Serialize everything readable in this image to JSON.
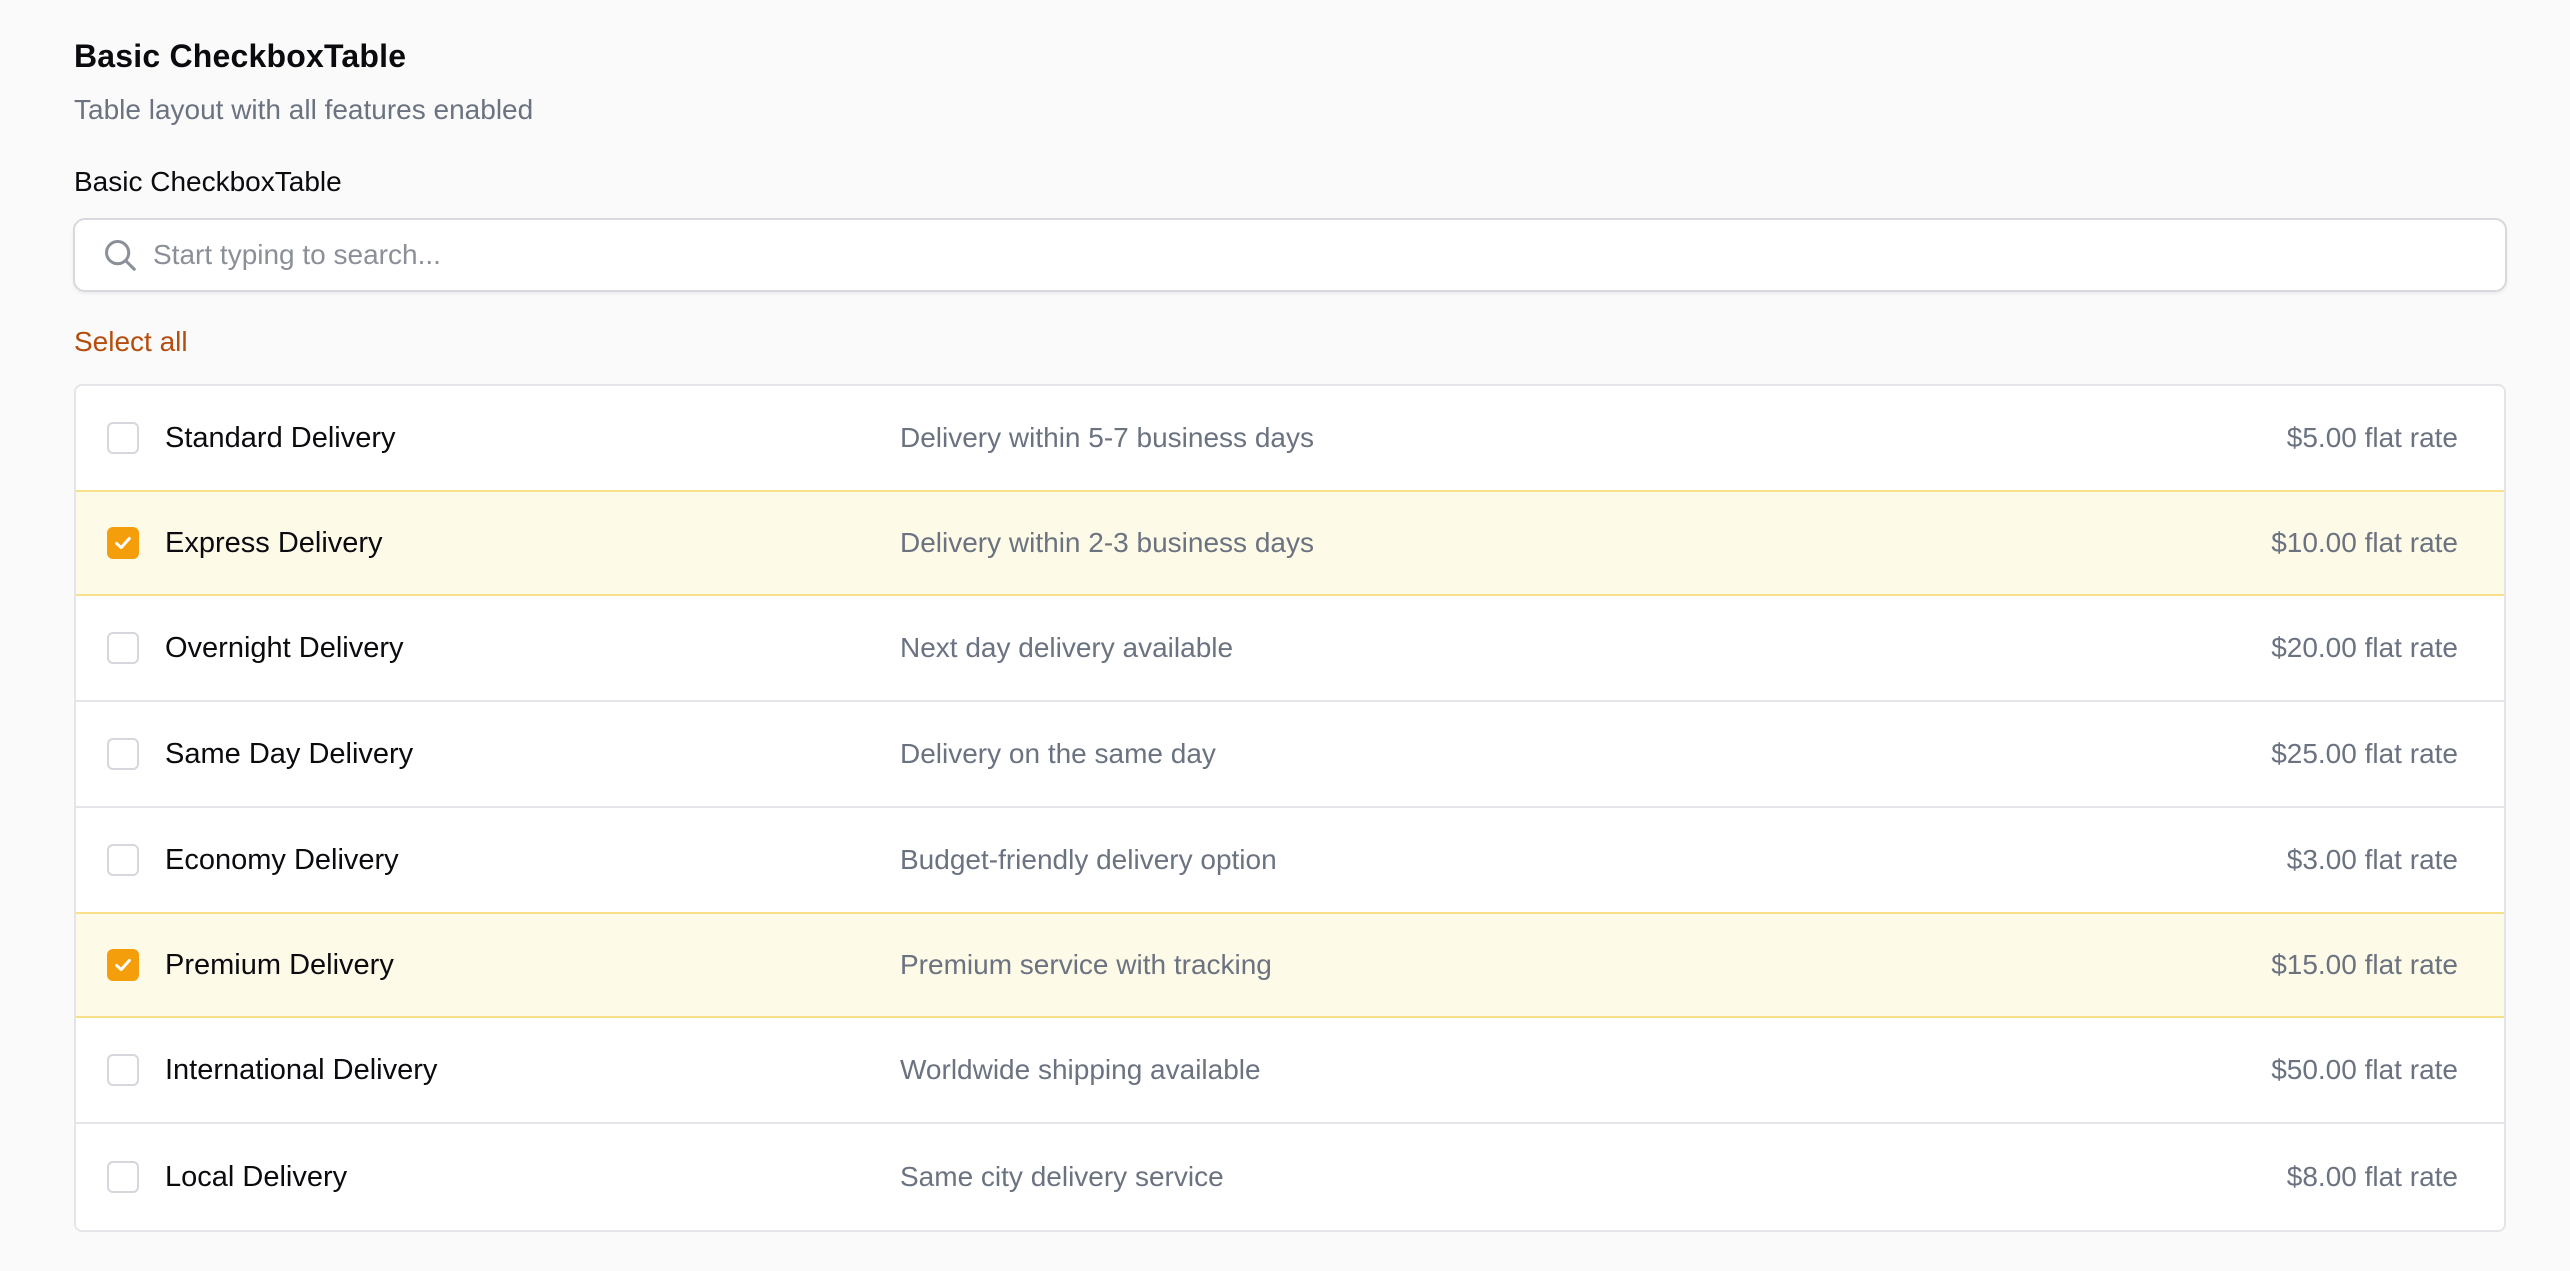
{
  "header": {
    "title": "Basic CheckboxTable",
    "subtitle": "Table layout with all features enabled"
  },
  "field": {
    "label": "Basic CheckboxTable"
  },
  "search": {
    "placeholder": "Start typing to search...",
    "value": "",
    "icon": "search-icon"
  },
  "select_all_label": "Select all",
  "colors": {
    "accent": "#f59e0b",
    "link": "#b44d0d",
    "selected_row_bg": "#fefae8",
    "selected_row_border": "#f7e08a"
  },
  "rows": [
    {
      "name": "Standard Delivery",
      "description": "Delivery within 5-7 business days",
      "price": "$5.00 flat rate",
      "checked": false
    },
    {
      "name": "Express Delivery",
      "description": "Delivery within 2-3 business days",
      "price": "$10.00 flat rate",
      "checked": true
    },
    {
      "name": "Overnight Delivery",
      "description": "Next day delivery available",
      "price": "$20.00 flat rate",
      "checked": false
    },
    {
      "name": "Same Day Delivery",
      "description": "Delivery on the same day",
      "price": "$25.00 flat rate",
      "checked": false
    },
    {
      "name": "Economy Delivery",
      "description": "Budget-friendly delivery option",
      "price": "$3.00 flat rate",
      "checked": false
    },
    {
      "name": "Premium Delivery",
      "description": "Premium service with tracking",
      "price": "$15.00 flat rate",
      "checked": true
    },
    {
      "name": "International Delivery",
      "description": "Worldwide shipping available",
      "price": "$50.00 flat rate",
      "checked": false
    },
    {
      "name": "Local Delivery",
      "description": "Same city delivery service",
      "price": "$8.00 flat rate",
      "checked": false
    }
  ]
}
